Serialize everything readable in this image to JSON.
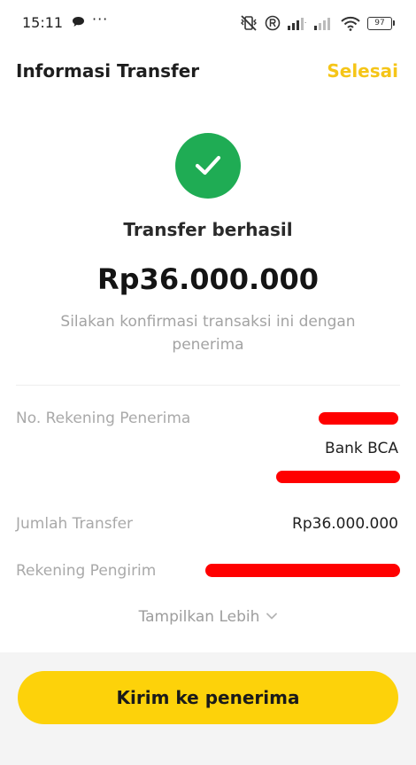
{
  "status_bar": {
    "time": "15:11",
    "overflow": "···",
    "battery": "97"
  },
  "header": {
    "title": "Informasi Transfer",
    "done_label": "Selesai"
  },
  "result": {
    "icon": "check-circle-icon",
    "status": "Transfer berhasil",
    "amount": "Rp36.000.000",
    "message": "Silakan konfirmasi transaksi ini dengan penerima"
  },
  "details": {
    "recipient_account_label": "No. Rekening Penerima",
    "recipient_bank": "Bank BCA",
    "transfer_amount_label": "Jumlah Transfer",
    "transfer_amount_value": "Rp36.000.000",
    "sender_account_label": "Rekening Pengirim"
  },
  "show_more_label": "Tampilkan Lebih",
  "primary_action_label": "Kirim ke penerima",
  "colors": {
    "accent_yellow": "#FDD20A",
    "link_yellow": "#F5C518",
    "success_green": "#1FAC54",
    "redaction_red": "#FF0000"
  }
}
